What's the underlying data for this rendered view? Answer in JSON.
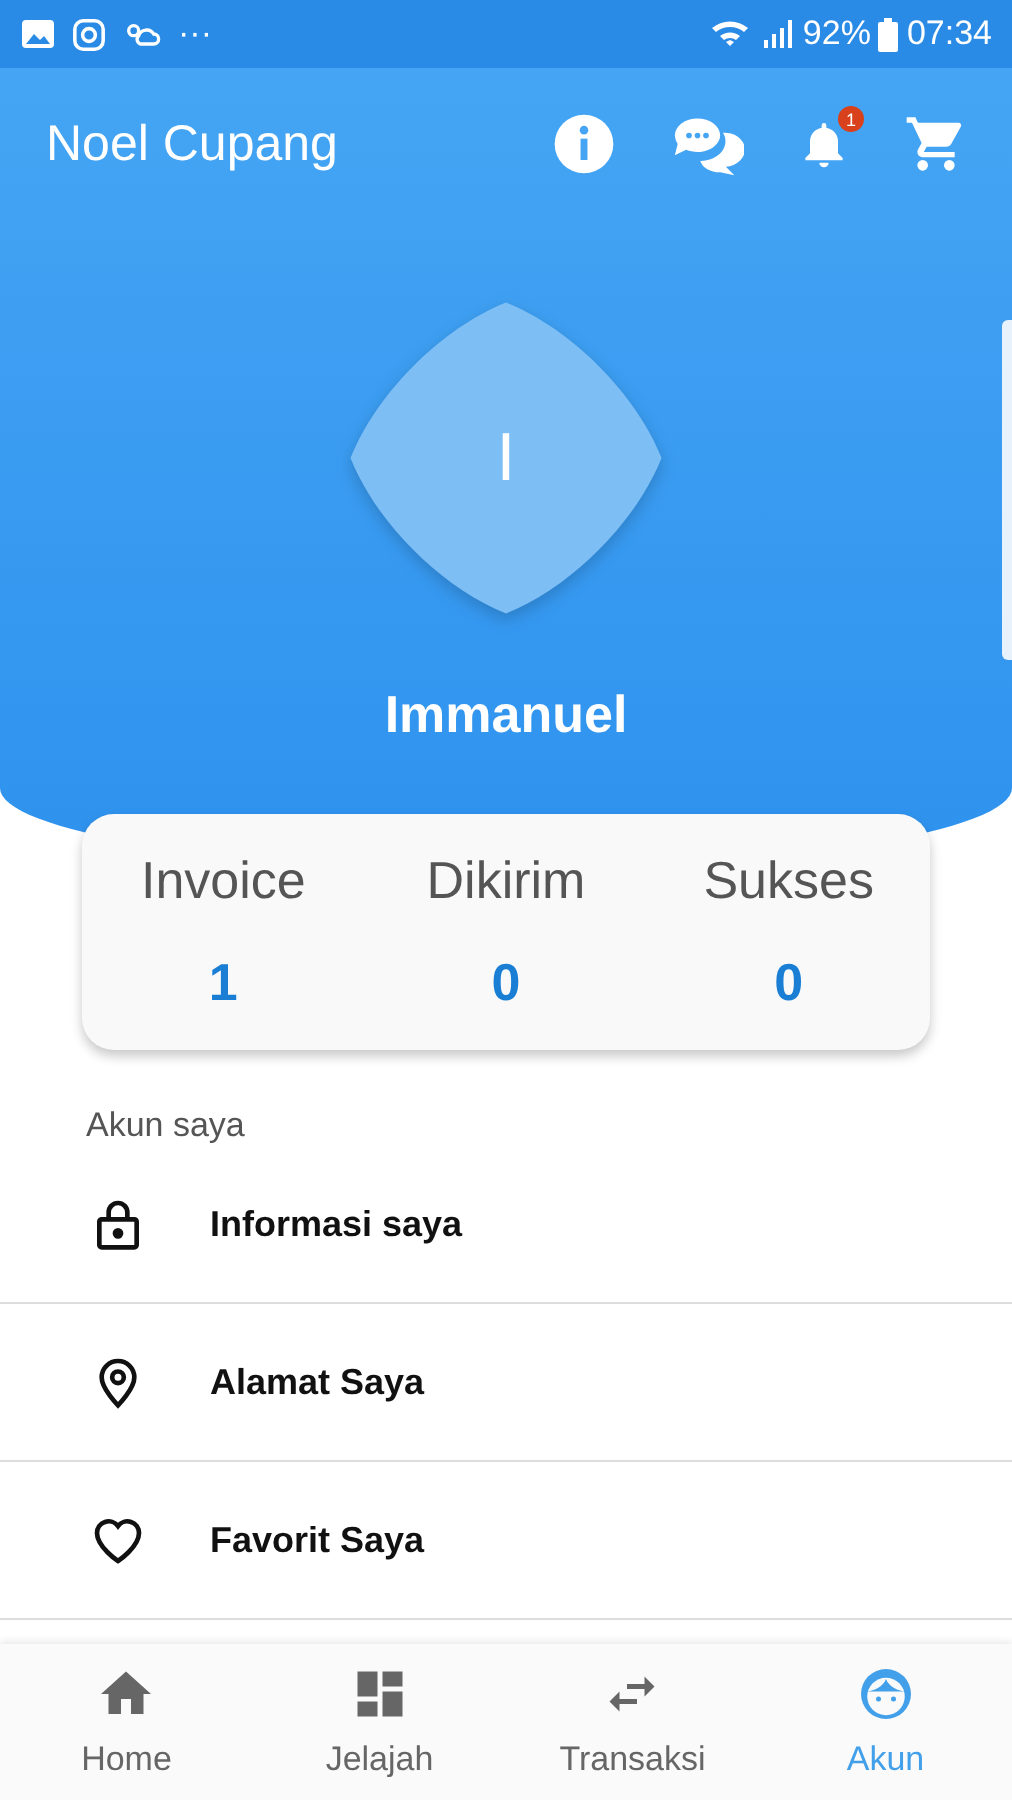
{
  "status_bar": {
    "battery": "92%",
    "time": "07:34",
    "overflow": "···"
  },
  "app_bar": {
    "title": "Noel Cupang",
    "notification_badge": "1"
  },
  "profile": {
    "initial": "I",
    "name": "Immanuel"
  },
  "stats": [
    {
      "label": "Invoice",
      "value": "1"
    },
    {
      "label": "Dikirim",
      "value": "0"
    },
    {
      "label": "Sukses",
      "value": "0"
    }
  ],
  "section_title": "Akun saya",
  "menu": [
    {
      "kind": "lock",
      "label": "Informasi saya"
    },
    {
      "kind": "pin",
      "label": "Alamat Saya"
    },
    {
      "kind": "heart",
      "label": "Favorit Saya"
    }
  ],
  "bottom_nav": [
    {
      "kind": "home",
      "label": "Home",
      "selected": false
    },
    {
      "kind": "grid",
      "label": "Jelajah",
      "selected": false
    },
    {
      "kind": "swap",
      "label": "Transaksi",
      "selected": false
    },
    {
      "kind": "face",
      "label": "Akun",
      "selected": true
    }
  ]
}
